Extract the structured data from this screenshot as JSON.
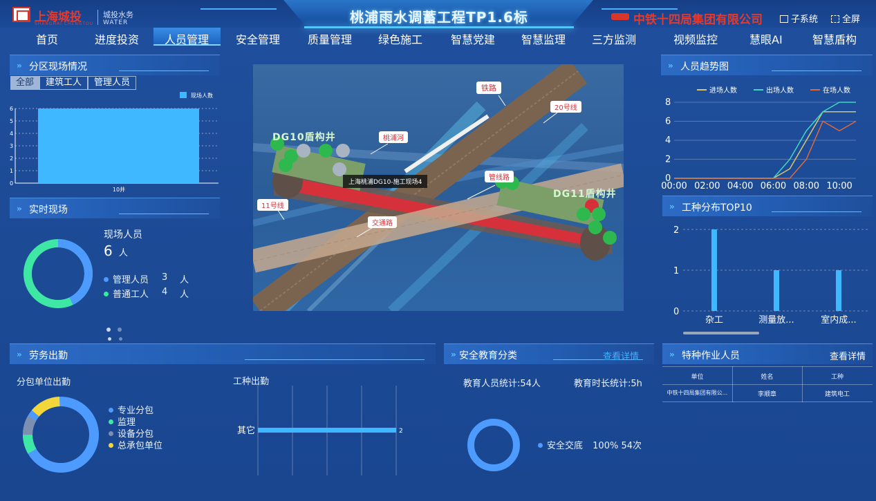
{
  "header": {
    "logo_cn": "上海城投",
    "logo_en": "SHANGHAI CHENGTOU",
    "logo_sub": "城投水务",
    "logo_sub2": "WATER",
    "title": "桃浦雨水调蓄工程TP1.6标",
    "company": "中铁十四局集团有限公司",
    "subsystem_label": "子系统",
    "fullscreen_label": "全屏"
  },
  "nav": {
    "items": [
      "首页",
      "进度投资",
      "人员管理",
      "安全管理",
      "质量管理",
      "绿色施工",
      "智慧党建",
      "智慧监理",
      "三方监测",
      "视频监控",
      "慧眼AI",
      "智慧盾构"
    ],
    "active": "人员管理"
  },
  "zone_panel": {
    "title": "分区现场情况",
    "tabs": [
      "全部",
      "建筑工人",
      "管理人员"
    ],
    "active_tab": "全部",
    "legend": "现场人数",
    "y_ticks": [
      "6",
      "5",
      "4",
      "3",
      "2",
      "1",
      "0"
    ],
    "category": "10井",
    "value": 6,
    "color": "#3fb8ff"
  },
  "realtime_panel": {
    "title": "实时现场",
    "label": "现场人员",
    "count": "6",
    "unit": "人",
    "rows": [
      {
        "name": "管理人员",
        "value": "3",
        "unit": "人",
        "color": "#4d9bff"
      },
      {
        "name": "普通工人",
        "value": "4",
        "unit": "人",
        "color": "#3ee8a4"
      }
    ]
  },
  "map": {
    "labels": {
      "railway": "铁路",
      "line20": "20号线",
      "river": "桃浦河",
      "line11": "11号线",
      "road": "交通路",
      "dg10": "DG10盾构井",
      "dg11": "DG11盾构井",
      "tooltip": "上海桃浦DG10-施工现场4",
      "hidden": "管线路"
    }
  },
  "trend_panel": {
    "title": "人员趋势图",
    "legend": [
      {
        "name": "进场人数",
        "color": "#d7c86a"
      },
      {
        "name": "出场人数",
        "color": "#3fd6c4"
      },
      {
        "name": "在场人数",
        "color": "#e0683a"
      }
    ],
    "y_ticks": [
      "8",
      "6",
      "4",
      "2",
      "0"
    ],
    "x_ticks": [
      "00:00",
      "02:00",
      "04:00",
      "06:00",
      "08:00",
      "10:00"
    ]
  },
  "worktype_panel": {
    "title": "工种分布TOP10",
    "y_ticks": [
      "2",
      "1",
      "0"
    ],
    "categories": [
      "杂工",
      "测量放...",
      "室内成..."
    ]
  },
  "labor_panel": {
    "title": "劳务出勤",
    "sub_left": "分包单位出勤",
    "sub_right": "工种出勤",
    "legend": [
      {
        "name": "专业分包",
        "color": "#4d9bff"
      },
      {
        "name": "监理",
        "color": "#3ee8a4"
      },
      {
        "name": "设备分包",
        "color": "#7c8fb0"
      },
      {
        "name": "总承包单位",
        "color": "#f2d63a"
      }
    ],
    "bar_label": "其它",
    "bar_value": "2"
  },
  "safety_panel": {
    "title": "安全教育分类",
    "link": "查看详情",
    "stat_people": "教育人员统计:54人",
    "stat_time": "教育时长统计:5h",
    "legend_name": "安全交底",
    "legend_value": "100%  54次"
  },
  "special_panel": {
    "title": "特种作业人员",
    "link": "查看详情",
    "headers": [
      "单位",
      "姓名",
      "工种"
    ],
    "rows": [
      [
        "中铁十四局集团有限公...",
        "李顺章",
        "建筑电工"
      ]
    ]
  },
  "chart_data": [
    {
      "type": "bar",
      "title": "",
      "categories": [
        "10井"
      ],
      "series": [
        {
          "name": "现场人数",
          "values": [
            6
          ]
        }
      ],
      "ylim": [
        0,
        6
      ]
    },
    {
      "type": "line",
      "title": "",
      "x": [
        "00:00",
        "01:00",
        "02:00",
        "03:00",
        "04:00",
        "05:00",
        "06:00",
        "07:00",
        "08:00",
        "09:00",
        "10:00",
        "11:00"
      ],
      "series": [
        {
          "name": "进场人数",
          "values": [
            0,
            0,
            0,
            0,
            0,
            0,
            0,
            1,
            4,
            7,
            7,
            7
          ]
        },
        {
          "name": "出场人数",
          "values": [
            0,
            0,
            0,
            0,
            0,
            0,
            0,
            2,
            5,
            7,
            8,
            8
          ]
        },
        {
          "name": "在场人数",
          "values": [
            0,
            0,
            0,
            0,
            0,
            0,
            0,
            0,
            2,
            6,
            5,
            6
          ]
        }
      ],
      "ylim": [
        0,
        8
      ]
    },
    {
      "type": "bar",
      "title": "",
      "categories": [
        "杂工",
        "测量放...",
        "室内成..."
      ],
      "values": [
        2,
        1,
        1
      ],
      "ylim": [
        0,
        2
      ]
    },
    {
      "type": "bar",
      "title": "",
      "categories": [
        "其它"
      ],
      "values": [
        2
      ],
      "xlim": [
        0,
        2
      ]
    }
  ]
}
